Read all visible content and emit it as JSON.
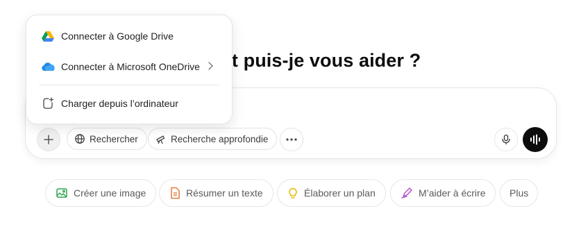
{
  "heading": {
    "text": "Comment puis-je vous aider ?"
  },
  "attach_menu": {
    "items": [
      {
        "label": "Connecter à Google Drive",
        "icon": "google-drive-icon"
      },
      {
        "label": "Connecter à Microsoft OneDrive",
        "icon": "onedrive-icon",
        "has_submenu": true
      },
      {
        "label": "Charger depuis l’ordinateur",
        "icon": "upload-file-icon"
      }
    ]
  },
  "composer": {
    "tools": [
      {
        "label": "Rechercher",
        "icon": "globe-icon"
      },
      {
        "label": "Recherche approfondie",
        "icon": "telescope-icon"
      }
    ],
    "more_icon": "ellipsis-icon",
    "plus_icon": "plus-icon",
    "mic_icon": "microphone-icon",
    "voice_icon": "voice-mode-icon"
  },
  "suggestions": [
    {
      "label": "Créer une image",
      "icon": "image-icon",
      "color": "#2ea44f"
    },
    {
      "label": "Résumer un texte",
      "icon": "document-icon",
      "color": "#e07b39"
    },
    {
      "label": "Élaborer un plan",
      "icon": "lightbulb-icon",
      "color": "#e6b800"
    },
    {
      "label": "M’aider à écrire",
      "icon": "pen-icon",
      "color": "#b455c8"
    },
    {
      "label": "Plus"
    }
  ]
}
